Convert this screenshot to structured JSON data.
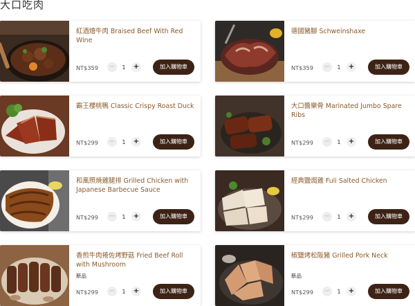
{
  "section": {
    "title": "大口吃肉"
  },
  "products": [
    {
      "name": "紅酒燴牛肉 Braised Beef With Red Wine",
      "price": "NT$359",
      "qty": "1",
      "badge": "",
      "minus": "−",
      "plus": "+",
      "cart_label": "加入購物車"
    },
    {
      "name": "德國豬腳 Schweinshaxe",
      "price": "NT$359",
      "qty": "1",
      "badge": "",
      "minus": "−",
      "plus": "+",
      "cart_label": "加入購物車"
    },
    {
      "name": "霸王櫻桃鴨 Classic Crispy Roast Duck",
      "price": "NT$299",
      "qty": "1",
      "badge": "",
      "minus": "−",
      "plus": "+",
      "cart_label": "加入購物車"
    },
    {
      "name": "大口醬樂骨 Marinated Jumbo Spare Ribs",
      "price": "NT$299",
      "qty": "1",
      "badge": "",
      "minus": "−",
      "plus": "+",
      "cart_label": "加入購物車"
    },
    {
      "name": "和風照燒雞腿排 Grilled Chicken with Japanese Barbecue Sauce",
      "price": "NT$299",
      "qty": "1",
      "badge": "",
      "minus": "−",
      "plus": "+",
      "cart_label": "加入購物車"
    },
    {
      "name": "經典鹽焗雞 Fuli Salted Chicken",
      "price": "NT$299",
      "qty": "1",
      "badge": "",
      "minus": "−",
      "plus": "+",
      "cart_label": "加入購物車"
    },
    {
      "name": "香煎牛肉捲佐烤野菇 Fried Beef Roll with Mushroom",
      "price": "NT$299",
      "qty": "1",
      "badge": "新品",
      "minus": "−",
      "plus": "+",
      "cart_label": "加入購物車"
    },
    {
      "name": "椒鹽烤松阪豬 Grilled Pork Neck",
      "price": "NT$299",
      "qty": "1",
      "badge": "新品",
      "minus": "−",
      "plus": "+",
      "cart_label": "加入購物車"
    }
  ],
  "colors": {
    "name_text": "#8a5a2c",
    "cart_button": "#3d2316",
    "card_bg": "#ffffff"
  }
}
